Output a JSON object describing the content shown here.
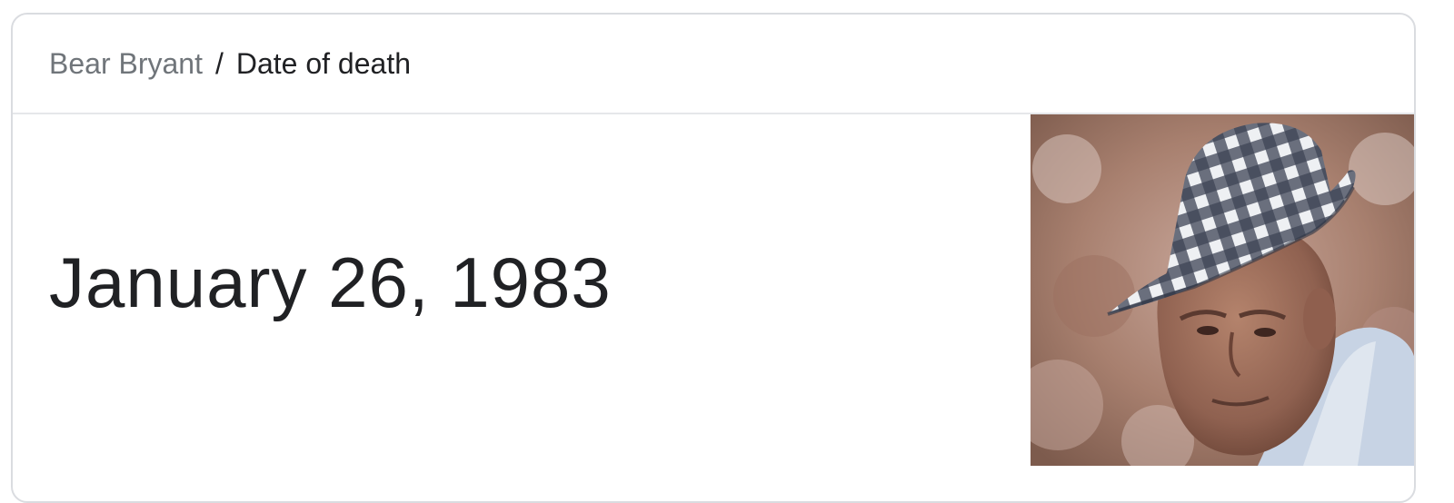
{
  "breadcrumb": {
    "entity": "Bear Bryant",
    "separator": "/",
    "attribute": "Date of death"
  },
  "answer": {
    "value": "January 26, 1983"
  },
  "colors": {
    "border": "#dadce0",
    "link_grey": "#70757a",
    "text": "#202124"
  }
}
